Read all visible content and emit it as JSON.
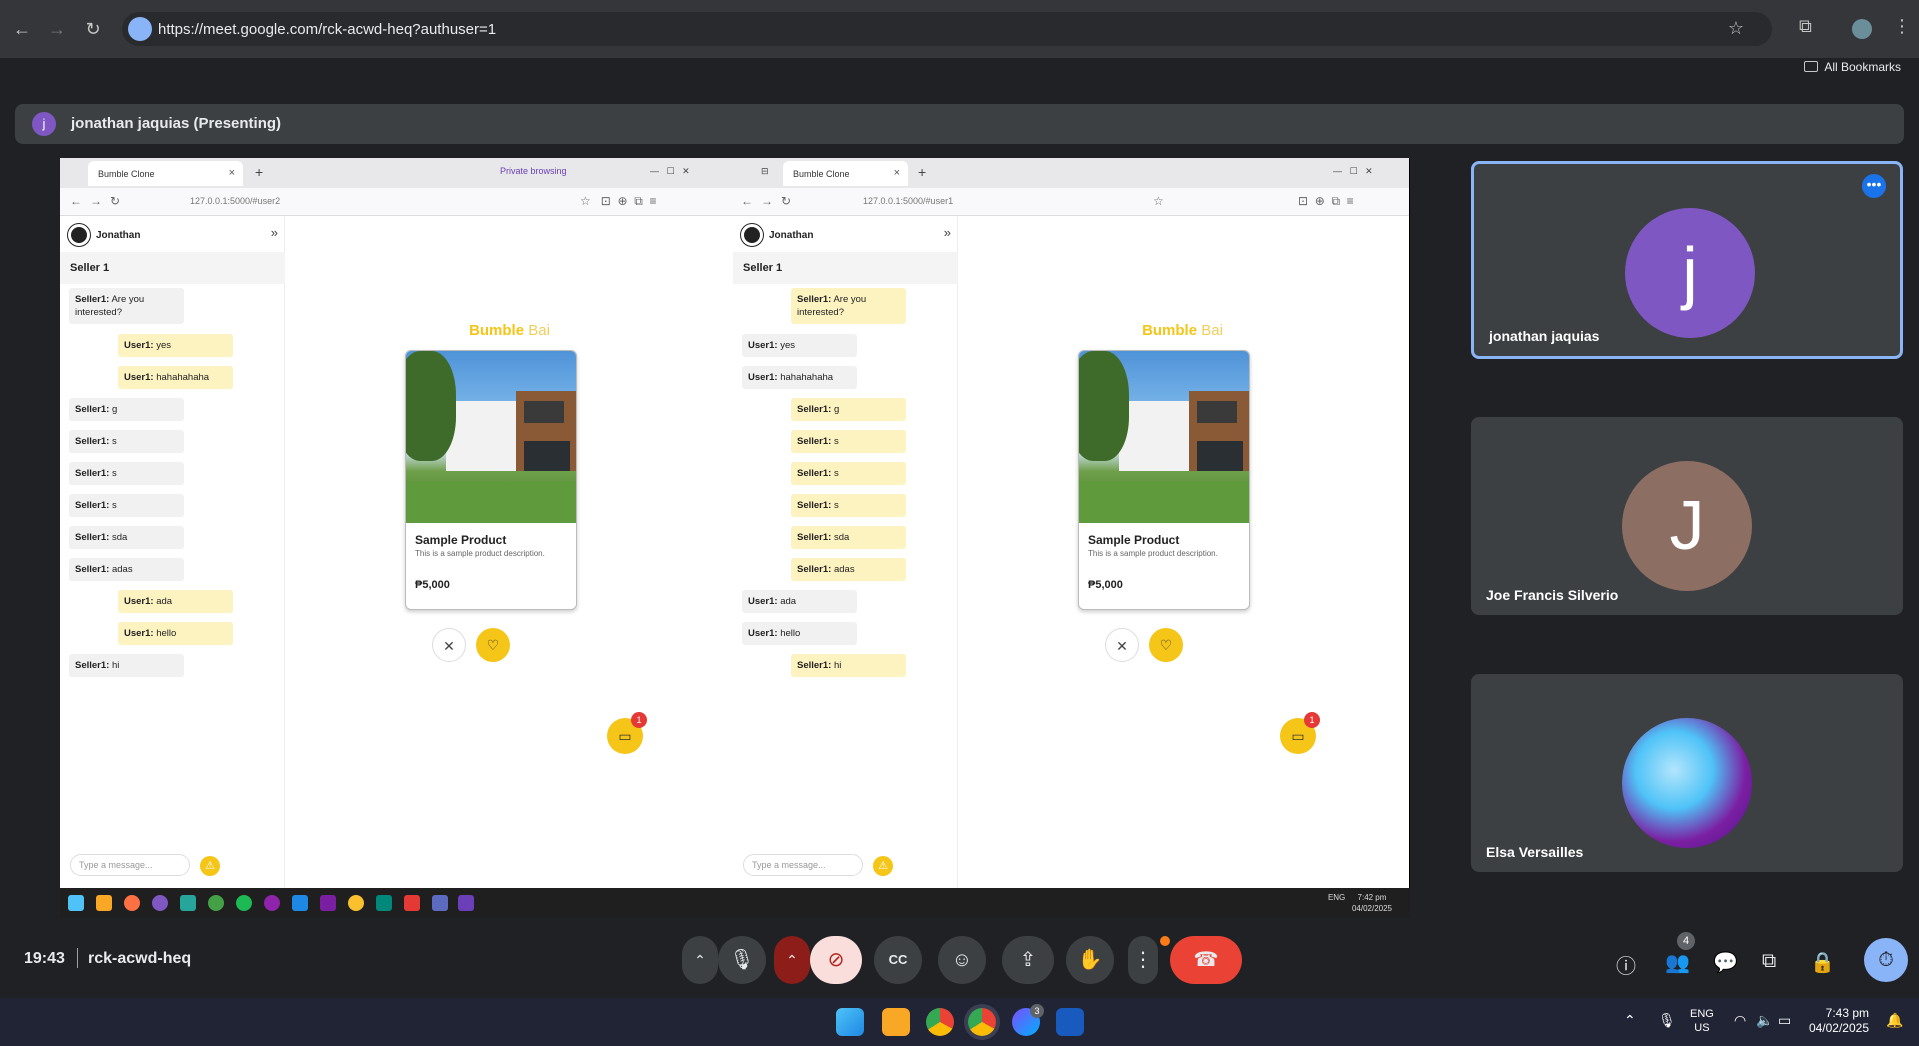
{
  "browser": {
    "url": "https://meet.google.com/rck-acwd-heq?authuser=1",
    "bookmarks_label": "All Bookmarks"
  },
  "meet": {
    "presenter_initial": "j",
    "presenting_text": "jonathan jaquias (Presenting)",
    "time": "19:43",
    "meeting_code": "rck-acwd-heq",
    "people_count": "4",
    "participants": [
      {
        "initial": "j",
        "name": "jonathan jaquias",
        "color": "#7e57c2"
      },
      {
        "initial": "J",
        "name": "Joe Francis Silverio",
        "color": "#8d6e63"
      },
      {
        "initial": "",
        "name": "Elsa Versailles",
        "color": "#4fc3f7"
      }
    ]
  },
  "shared": {
    "left": {
      "tab_title": "Bumble Clone",
      "private_label": "Private browsing",
      "address": "127.0.0.1:5000/#user2",
      "user_name": "Jonathan",
      "seller_tab": "Seller 1",
      "messages": [
        {
          "from": "Seller1:",
          "text": " Are you interested?",
          "dir": "in"
        },
        {
          "from": "User1:",
          "text": " yes",
          "dir": "out"
        },
        {
          "from": "User1:",
          "text": " hahahahaha",
          "dir": "out"
        },
        {
          "from": "Seller1:",
          "text": " g",
          "dir": "in"
        },
        {
          "from": "Seller1:",
          "text": " s",
          "dir": "in"
        },
        {
          "from": "Seller1:",
          "text": " s",
          "dir": "in"
        },
        {
          "from": "Seller1:",
          "text": " s",
          "dir": "in"
        },
        {
          "from": "Seller1:",
          "text": " sda",
          "dir": "in"
        },
        {
          "from": "Seller1:",
          "text": " adas",
          "dir": "in"
        },
        {
          "from": "User1:",
          "text": " ada",
          "dir": "out"
        },
        {
          "from": "User1:",
          "text": " hello",
          "dir": "out"
        },
        {
          "from": "Seller1:",
          "text": " hi",
          "dir": "in"
        }
      ],
      "compose_placeholder": "Type a message...",
      "badge": "1"
    },
    "right": {
      "tab_title": "Bumble Clone",
      "address": "127.0.0.1:5000/#user1",
      "user_name": "Jonathan",
      "seller_tab": "Seller 1",
      "messages": [
        {
          "from": "Seller1:",
          "text": " Are you interested?",
          "dir": "out"
        },
        {
          "from": "User1:",
          "text": " yes",
          "dir": "in"
        },
        {
          "from": "User1:",
          "text": " hahahahaha",
          "dir": "in"
        },
        {
          "from": "Seller1:",
          "text": " g",
          "dir": "out"
        },
        {
          "from": "Seller1:",
          "text": " s",
          "dir": "out"
        },
        {
          "from": "Seller1:",
          "text": " s",
          "dir": "out"
        },
        {
          "from": "Seller1:",
          "text": " s",
          "dir": "out"
        },
        {
          "from": "Seller1:",
          "text": " sda",
          "dir": "out"
        },
        {
          "from": "Seller1:",
          "text": " adas",
          "dir": "out"
        },
        {
          "from": "User1:",
          "text": " ada",
          "dir": "in"
        },
        {
          "from": "User1:",
          "text": " hello",
          "dir": "in"
        },
        {
          "from": "Seller1:",
          "text": " hi",
          "dir": "out"
        }
      ],
      "compose_placeholder": "Type a message...",
      "badge": "1"
    },
    "brand_a": "Bumble",
    "brand_b": " Bai",
    "product_title": "Sample Product",
    "product_desc": "This is a sample product description.",
    "product_price": "₱5,000",
    "inner_tray_lang": "ENG",
    "inner_tray_time": "7:42 pm",
    "inner_tray_date": "04/02/2025"
  },
  "taskbar": {
    "lang": "ENG",
    "region": "US",
    "time": "7:43 pm",
    "date": "04/02/2025",
    "messenger_badge": "3"
  }
}
